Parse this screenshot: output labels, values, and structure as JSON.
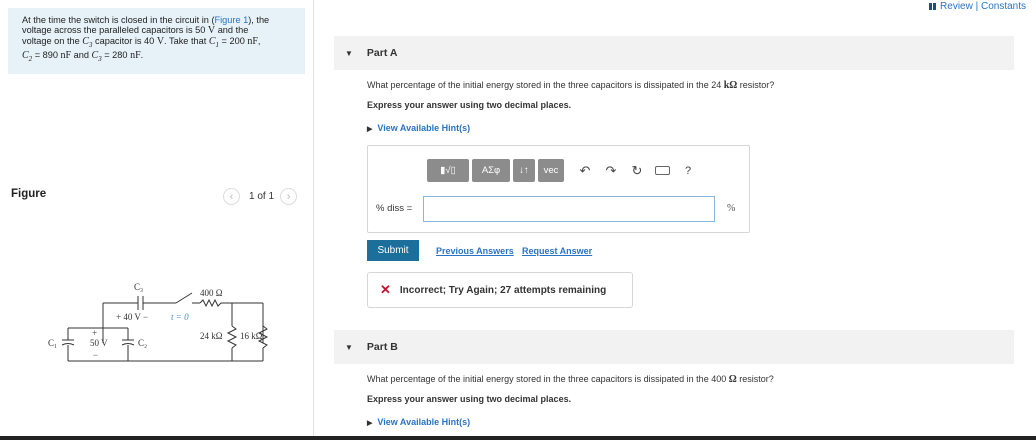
{
  "problem": {
    "t1": "At the time the switch is closed in the circuit in (",
    "figure_link": "Figure 1",
    "t2": "), the",
    "t3": "voltage across the paralleled capacitors is 50 ",
    "v_sym": "V",
    "t4": " and the",
    "t5": "voltage on the ",
    "c3_sym": "C",
    "c3_sub": "3",
    "t6": " capacitor is 40 ",
    "t7": ". Take that ",
    "c1_sym": "C",
    "c1_sub": "1",
    "c1_val": " = 200 ",
    "nf": "nF",
    "c2_sym": "C",
    "c2_sub": "2",
    "c2_val": " = 890 ",
    "and": " and ",
    "c3_val": " = 280 "
  },
  "figure": {
    "label": "Figure",
    "pager_text": "1 of 1",
    "prev": "‹",
    "next": "›"
  },
  "circuit": {
    "c3": "C₃",
    "v40": "+ 40 V −",
    "t0": "t = 0",
    "r400": "400 Ω",
    "r24": "24 kΩ",
    "r16": "16 kΩ",
    "c1": "C₁",
    "v50": "50 V",
    "c2": "C₂",
    "plus": "+",
    "minus": "−"
  },
  "header": {
    "review_link": "Review | Constants"
  },
  "part_a": {
    "title": "Part A",
    "question_1": "What percentage of the initial energy stored in the three capacitors is dissipated in the 24 ",
    "question_unit": "kΩ",
    "question_2": " resistor?",
    "instruction": "Express your answer using two decimal places.",
    "hint": "View Available Hint(s)",
    "answer_label": "% diss =",
    "answer_value": "",
    "unit": "%",
    "toolbar": {
      "templates": "▮√▯",
      "greek": "AΣφ",
      "arrows": "↓↑",
      "vec": "vec",
      "undo": "↶",
      "redo": "↷",
      "reset": "↻",
      "help": "?"
    },
    "submit": "Submit",
    "previous_answers": "Previous Answers",
    "request_answer": "Request Answer",
    "feedback": "Incorrect; Try Again; 27 attempts remaining",
    "feedback_icon": "✕"
  },
  "part_b": {
    "title": "Part B",
    "question_1": "What percentage of the initial energy stored in the three capacitors is dissipated in the 400 ",
    "question_unit": "Ω",
    "question_2": " resistor?",
    "instruction": "Express your answer using two decimal places.",
    "hint": "View Available Hint(s)"
  },
  "icons": {
    "caret": "▼",
    "hint_triangle": "▶"
  },
  "colors": {
    "link": "#2a73c4",
    "submit": "#1c6e9b",
    "error": "#c8102e",
    "problem_bg": "#e6f2f8"
  }
}
